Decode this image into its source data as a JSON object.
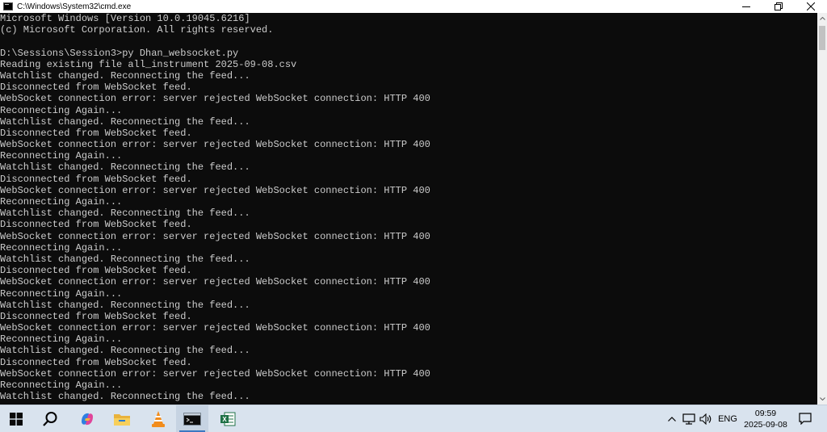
{
  "window": {
    "title": "C:\\Windows\\System32\\cmd.exe"
  },
  "console": {
    "lines": [
      "Microsoft Windows [Version 10.0.19045.6216]",
      "(c) Microsoft Corporation. All rights reserved.",
      "",
      "D:\\Sessions\\Session3>py Dhan_websocket.py",
      "Reading existing file all_instrument 2025-09-08.csv",
      "Watchlist changed. Reconnecting the feed...",
      "Disconnected from WebSocket feed.",
      "WebSocket connection error: server rejected WebSocket connection: HTTP 400",
      "Reconnecting Again...",
      "Watchlist changed. Reconnecting the feed...",
      "Disconnected from WebSocket feed.",
      "WebSocket connection error: server rejected WebSocket connection: HTTP 400",
      "Reconnecting Again...",
      "Watchlist changed. Reconnecting the feed...",
      "Disconnected from WebSocket feed.",
      "WebSocket connection error: server rejected WebSocket connection: HTTP 400",
      "Reconnecting Again...",
      "Watchlist changed. Reconnecting the feed...",
      "Disconnected from WebSocket feed.",
      "WebSocket connection error: server rejected WebSocket connection: HTTP 400",
      "Reconnecting Again...",
      "Watchlist changed. Reconnecting the feed...",
      "Disconnected from WebSocket feed.",
      "WebSocket connection error: server rejected WebSocket connection: HTTP 400",
      "Reconnecting Again...",
      "Watchlist changed. Reconnecting the feed...",
      "Disconnected from WebSocket feed.",
      "WebSocket connection error: server rejected WebSocket connection: HTTP 400",
      "Reconnecting Again...",
      "Watchlist changed. Reconnecting the feed...",
      "Disconnected from WebSocket feed.",
      "WebSocket connection error: server rejected WebSocket connection: HTTP 400",
      "Reconnecting Again...",
      "Watchlist changed. Reconnecting the feed..."
    ]
  },
  "taskbar": {
    "icons": [
      "windows-start-icon",
      "search-icon",
      "copilot-icon",
      "file-explorer-icon",
      "vlc-icon",
      "command-prompt-icon",
      "excel-icon"
    ],
    "language": "ENG",
    "time": "09:59",
    "date": "2025-09-08"
  },
  "colors": {
    "console_bg": "#0c0c0c",
    "console_text": "#cccccc",
    "taskbar_bg": "#d9e3ee",
    "accent": "#3b78c2"
  }
}
